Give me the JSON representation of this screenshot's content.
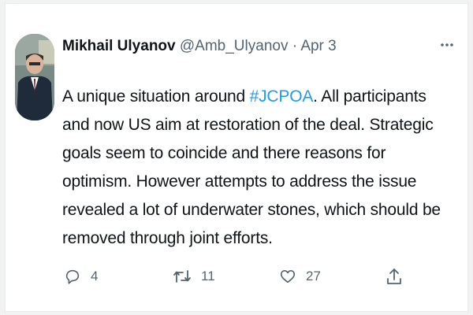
{
  "tweet": {
    "author": {
      "display_name": "Mikhail Ulyanov",
      "handle": "@Amb_Ulyanov",
      "separator": "·",
      "date": "Apr 3"
    },
    "text": {
      "before_hashtag": "A unique situation around ",
      "hashtag": "#JCPOA",
      "after_hashtag": ". All participants and now US aim at restoration of the deal. Strategic goals seem to coincide and there reasons for optimism. However attempts to address the issue revealed a lot of underwater stones, which should be removed through joint efforts."
    },
    "actions": {
      "reply_count": "4",
      "retweet_count": "11",
      "like_count": "27"
    },
    "icons": [
      "more-icon",
      "reply-icon",
      "retweet-icon",
      "like-icon",
      "share-icon"
    ],
    "colors": {
      "hashtag": "#1d9bf0",
      "secondary_text": "#536471",
      "primary_text": "#0f1419"
    }
  }
}
